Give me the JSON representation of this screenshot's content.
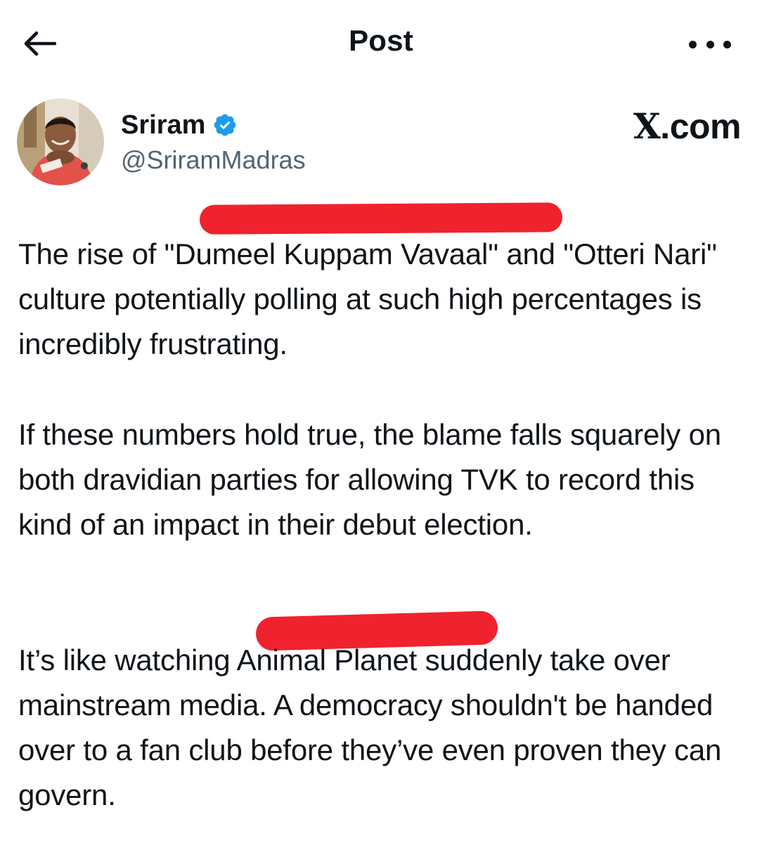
{
  "header": {
    "title": "Post",
    "back_icon": "arrow-left-icon",
    "more_icon": "ellipsis-horizontal-icon"
  },
  "author": {
    "display_name": "Sriram",
    "handle": "@SriramMadras",
    "verified_icon": "verified-badge-icon",
    "verified_color": "#1d9bf0"
  },
  "watermark": {
    "x": "X",
    "text": ".com"
  },
  "post": {
    "paragraphs": [
      "The rise of \"Dumeel Kuppam Vavaal\" and \"Otteri Nari\" culture potentially polling at such high percentages is incredibly frustrating.",
      "If these numbers hold true, the blame falls squarely on both dravidian parties for allowing TVK to record this kind of an impact in their debut election.",
      "It’s like watching Animal Planet suddenly take over mainstream media. A democracy shouldn't be handed over to a fan club before they’ve even proven they can govern."
    ]
  },
  "colors": {
    "text": "#0f1419",
    "secondary": "#536471",
    "redaction": "#f0222e"
  }
}
